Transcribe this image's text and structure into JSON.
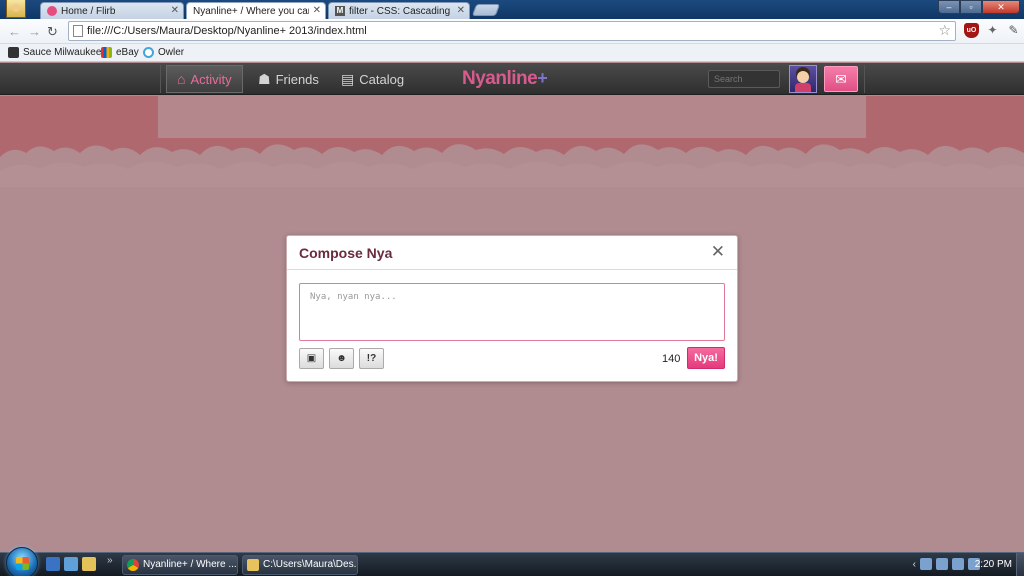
{
  "browser": {
    "tabs": [
      {
        "title": "Home / Flirb",
        "icon": "flirb-icon"
      },
      {
        "title": "Nyanline+ / Where you can post",
        "icon": "nyanline-icon"
      },
      {
        "title": "filter - CSS: Cascading Style",
        "icon": "mdn-icon"
      }
    ],
    "url": "file:///C:/Users/Maura/Desktop/Nyanline+ 2013/index.html",
    "bookmarks": [
      "Sauce Milwaukee",
      "eBay",
      "Owler"
    ]
  },
  "site": {
    "nav": [
      {
        "label": "Activity",
        "icon": "house-icon",
        "active": true
      },
      {
        "label": "Friends",
        "icon": "friends-icon",
        "active": false
      },
      {
        "label": "Catalog",
        "icon": "book-icon",
        "active": false
      }
    ],
    "logo": "Nyanline",
    "logo_plus": "+",
    "search_placeholder": "Search"
  },
  "modal": {
    "title": "Compose Nya",
    "placeholder": "Nya, nyan nya...",
    "tools": [
      {
        "name": "image-icon",
        "glyph": "▣"
      },
      {
        "name": "emoticon-icon",
        "glyph": "☻"
      },
      {
        "name": "interrobang-icon",
        "glyph": "!?"
      }
    ],
    "counter": "140",
    "submit": "Nya!"
  },
  "taskbar": {
    "tasks": [
      "Nyanline+ / Where ...",
      "C:\\Users\\Maura\\Des..."
    ],
    "time": "2:20 PM"
  },
  "colors": {
    "accent": "#e43a7d",
    "page_bg": "#b08b90",
    "band_bg": "#b0686f",
    "title": "#6b2b3c"
  }
}
